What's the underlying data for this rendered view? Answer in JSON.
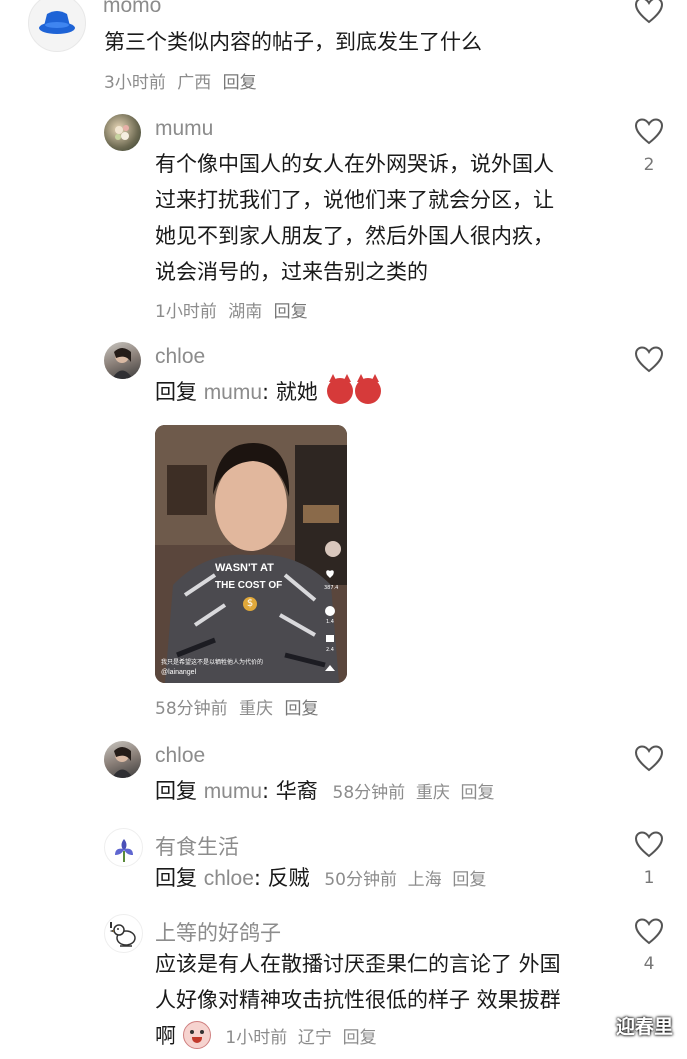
{
  "comments": [
    {
      "username": "momo",
      "text": "第三个类似内容的帖子，到底发生了什么",
      "time": "3小时前",
      "location": "广西",
      "reply_label": "回复",
      "likes": ""
    },
    {
      "username": "mumu",
      "text_lines": [
        "有个像中国人的女人在外网哭诉，说外国人",
        "过来打扰我们了，说他们来了就会分区，让",
        "她见不到家人朋友了，然后外国人很内疚，",
        "说会消号的，过来告别之类的"
      ],
      "time": "1小时前",
      "location": "湖南",
      "reply_label": "回复",
      "likes": "2"
    },
    {
      "username": "chloe",
      "reply_prefix": "回复",
      "reply_target": "mumu",
      "text": ": 就她",
      "emoji": "devil-emoji",
      "video": {
        "caption_line1": "WASN'T AT",
        "caption_line2": "THE COST OF",
        "subtitle": "我只是希望这不是以牺牲他人为代价的",
        "handle": "@lainangel",
        "stats": [
          "387.4",
          "1.4",
          "2.4"
        ]
      },
      "time": "58分钟前",
      "location": "重庆",
      "reply_label": "回复",
      "likes": ""
    },
    {
      "username": "chloe",
      "reply_prefix": "回复",
      "reply_target": "mumu",
      "text": ": 华裔",
      "time": "58分钟前",
      "location": "重庆",
      "reply_label": "回复",
      "likes": ""
    },
    {
      "username": "有食生活",
      "reply_prefix": "回复",
      "reply_target": "chloe",
      "text": ": 反贼",
      "time": "50分钟前",
      "location": "上海",
      "reply_label": "回复",
      "likes": "1"
    },
    {
      "username": "上等的好鸽子",
      "text_lines": [
        "应该是有人在散播讨厌歪果仁的言论了 外国",
        "人好像对精神攻击抗性很低的样子 效果拔群",
        "啊"
      ],
      "time": "1小时前",
      "location": "辽宁",
      "reply_label": "回复",
      "likes": "4"
    }
  ],
  "watermark": "迎春里",
  "colors": {
    "meta": "#8c8c8c",
    "text": "#1a1a1a",
    "heart_stroke": "#555555"
  }
}
